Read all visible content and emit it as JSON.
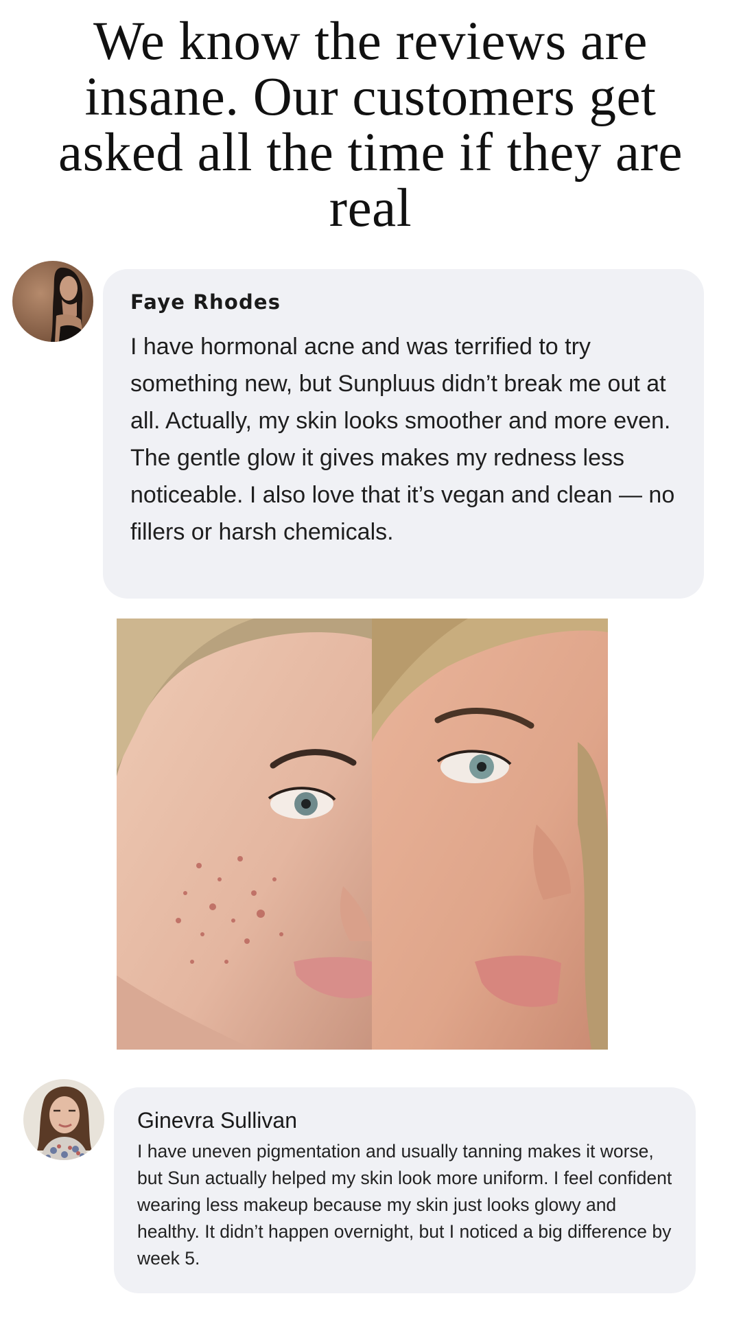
{
  "headline": "We know the reviews are insane. Our customers get asked all the time if they are real",
  "reviews": [
    {
      "name": "Faye Rhodes",
      "text": "I have hormonal acne and was terrified to try something new, but Sunpluus didn’t break me out at all. Actually, my skin looks smoother and more even. The gentle glow it gives makes my redness less noticeable. I also love that it’s vegan and clean — no fillers or harsh chemicals.",
      "avatar_icon": "woman-dark-hair-portrait"
    },
    {
      "name": "Ginevra Sullivan",
      "text": "I have uneven pigmentation and usually tanning makes it worse, but Sun actually helped my skin look more uniform. I feel confident wearing less makeup because my skin just looks glowy and healthy. It didn’t happen overnight, but I noticed a big difference by week 5.",
      "avatar_icon": "woman-brown-hair-portrait"
    }
  ],
  "before_after_image": {
    "panels": [
      "before",
      "after"
    ]
  },
  "colors": {
    "bubble_bg": "#f0f1f5",
    "text": "#1a1a1a",
    "background": "#ffffff"
  }
}
